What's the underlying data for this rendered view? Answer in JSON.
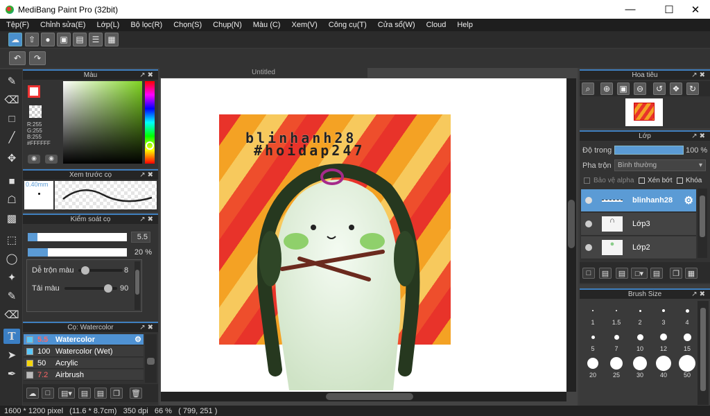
{
  "window": {
    "title": "MediBang Paint Pro (32bit)"
  },
  "menu": [
    "Tệp(F)",
    "Chỉnh sửa(E)",
    "Lớp(L)",
    "Bộ lọc(R)",
    "Chọn(S)",
    "Chụp(N)",
    "Màu (C)",
    "Xem(V)",
    "Công cụ(T)",
    "Cửa sổ(W)",
    "Cloud",
    "Help"
  ],
  "color_panel": {
    "title": "Màu",
    "rgb_r": "R:255",
    "rgb_g": "G:255",
    "rgb_b": "B:255",
    "hex": "#FFFFFF"
  },
  "brush_preview": {
    "title": "Xem trước cọ",
    "size": "0.40mm"
  },
  "brush_control": {
    "title": "Kiểm soát cọ",
    "size_value": "5.5",
    "opacity_value": "20 %",
    "mix_label": "Dễ trộn màu",
    "mix_value": "8",
    "reload_label": "Tải màu",
    "reload_value": "90"
  },
  "brush_list": {
    "title": "Cọ: Watercolor",
    "items": [
      {
        "num": "5.5",
        "name": "Watercolor",
        "color": "#5ac8fa"
      },
      {
        "num": "100",
        "name": "Watercolor (Wet)",
        "color": "#5ac8fa"
      },
      {
        "num": "50",
        "name": "Acrylic",
        "color": "#f5d50a"
      },
      {
        "num": "7.2",
        "name": "Airbrush",
        "color": "#bbbbbb"
      }
    ]
  },
  "document": {
    "tab": "Untitled"
  },
  "artwork": {
    "line1": "blinhanh28",
    "line2": "#hoidap247"
  },
  "navigator": {
    "title": "Hoa tiêu"
  },
  "layers": {
    "title": "Lớp",
    "opacity_label": "Độ trong",
    "opacity_value": "100 %",
    "blend_label": "Pha trộn",
    "blend_value": "Bình thường",
    "alpha_lock": "Bảo vệ alpha",
    "clip": "Xén bớt",
    "lock": "Khóa",
    "items": [
      {
        "name": "blinhanh28"
      },
      {
        "name": "Lớp3"
      },
      {
        "name": "Lớp2"
      }
    ]
  },
  "brush_size": {
    "title": "Brush Size",
    "sizes": [
      "1",
      "1.5",
      "2",
      "3",
      "4",
      "5",
      "7",
      "10",
      "12",
      "15",
      "20",
      "25",
      "30",
      "40",
      "50"
    ]
  },
  "status": {
    "text": "1600 * 1200 pixel   (11.6 * 8.7cm)   350 dpi   66 %   ( 799, 251 )"
  }
}
